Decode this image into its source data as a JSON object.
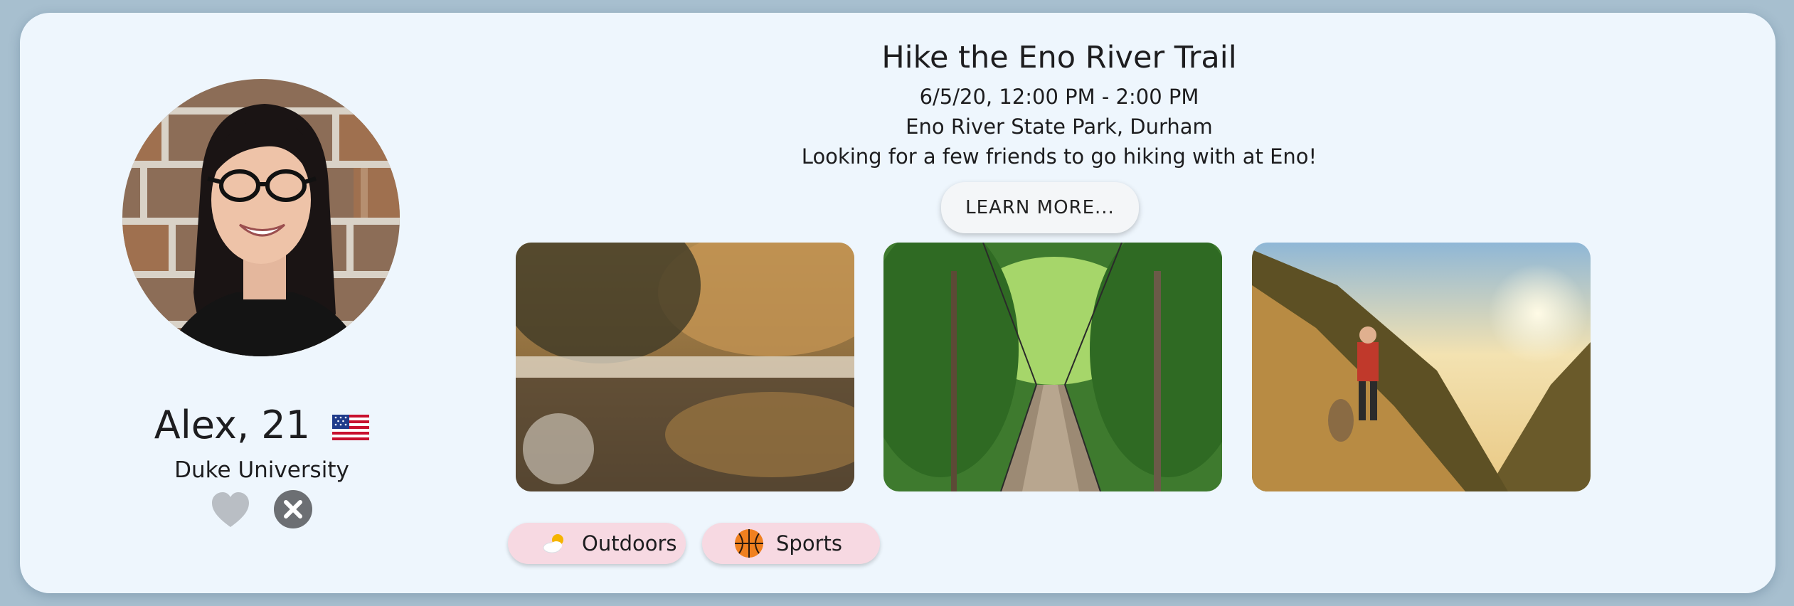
{
  "profile": {
    "name_age": "Alex, 21",
    "school": "Duke University",
    "flag_icon": "us-flag-icon",
    "actions": {
      "like_icon": "heart-icon",
      "dismiss_icon": "close-icon"
    }
  },
  "event": {
    "title": "Hike the Eno River Trail",
    "datetime": "6/5/20, 12:00 PM - 2:00 PM",
    "location": "Eno River State Park, Durham",
    "description": "Looking for a few friends to go hiking with at Eno!",
    "learn_more_label": "LEARN MORE..."
  },
  "tags": [
    {
      "label": "Outdoors",
      "icon": "partly-cloudy-icon"
    },
    {
      "label": "Sports",
      "icon": "basketball-icon"
    }
  ],
  "colors": {
    "background": "#a7bfcf",
    "card": "#eef6fd",
    "tag": "#f7d9e2",
    "heart": "#b9bec4",
    "close": "#6c6f73"
  }
}
